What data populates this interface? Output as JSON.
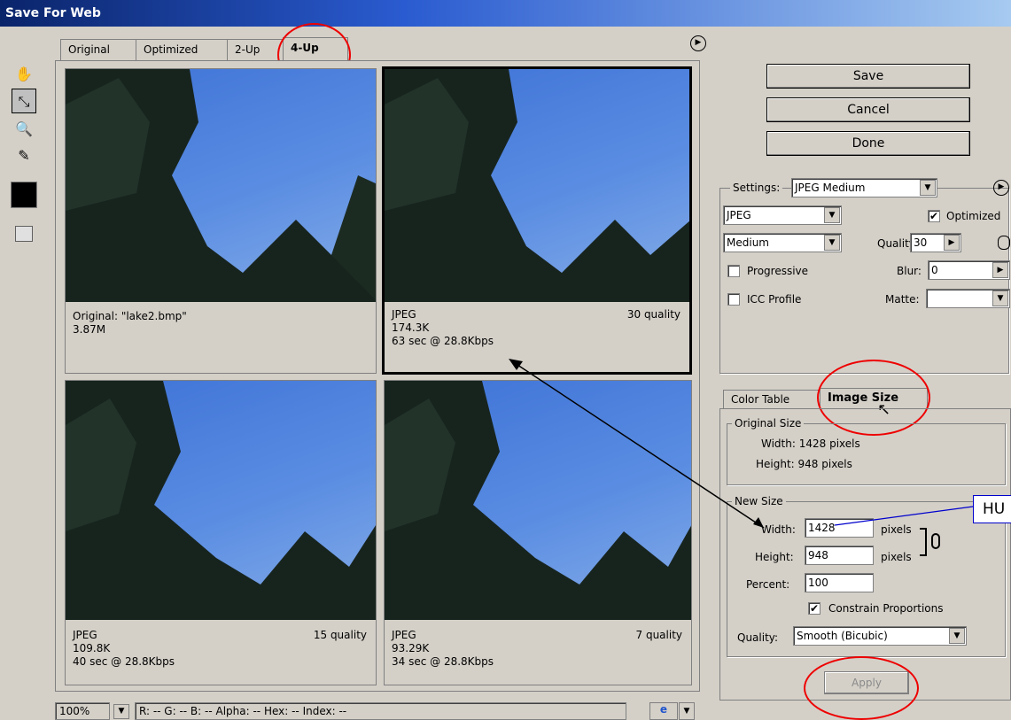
{
  "window": {
    "title": "Save For Web"
  },
  "tabs": [
    {
      "label": "Original"
    },
    {
      "label": "Optimized"
    },
    {
      "label": "2-Up"
    },
    {
      "label": "4-Up",
      "active": true
    }
  ],
  "tools": [
    "hand-icon",
    "slice-select-icon",
    "zoom-icon",
    "eyedropper-icon"
  ],
  "panes": {
    "original": {
      "name": "Original: \"lake2.bmp\"",
      "size": "3.87M"
    },
    "pane2": {
      "format": "JPEG",
      "quality": "30 quality",
      "size": "174.3K",
      "time": "63 sec @ 28.8Kbps"
    },
    "pane3": {
      "format": "JPEG",
      "quality": "15 quality",
      "size": "109.8K",
      "time": "40 sec @ 28.8Kbps"
    },
    "pane4": {
      "format": "JPEG",
      "quality": "7 quality",
      "size": "93.29K",
      "time": "34 sec @ 28.8Kbps"
    }
  },
  "buttons": {
    "save": "Save",
    "cancel": "Cancel",
    "done": "Done",
    "apply": "Apply"
  },
  "settings": {
    "label": "Settings:",
    "preset": "JPEG Medium",
    "format": "JPEG",
    "quality_preset": "Medium",
    "optimized_label": "Optimized",
    "optimized_checked": true,
    "quality_label": "Quality:",
    "quality_value": "30",
    "progressive_label": "Progressive",
    "blur_label": "Blur:",
    "blur_value": "0",
    "icc_label": "ICC Profile",
    "matte_label": "Matte:"
  },
  "size_tabs": {
    "color_table": "Color Table",
    "image_size": "Image Size"
  },
  "original_size": {
    "legend": "Original Size",
    "width": "Width: 1428 pixels",
    "height": "Height: 948 pixels"
  },
  "new_size": {
    "legend": "New Size",
    "width_label": "Width:",
    "width_value": "1428",
    "height_label": "Height:",
    "height_value": "948",
    "pixels": "pixels",
    "percent_label": "Percent:",
    "percent_value": "100",
    "constrain_label": "Constrain Proportions",
    "constrain_checked": true,
    "quality_label": "Quality:",
    "quality_value": "Smooth (Bicubic)"
  },
  "annotation": {
    "callout_text": "HU"
  },
  "status_bar": {
    "zoom": "100%",
    "readout": "R:   --   G:   --   B:   --   Alpha:    --  Hex:           --  Index:    --"
  },
  "colors": {
    "swatch": "#000000",
    "annotation_red": "#e00000",
    "annotation_blue": "#0000cc"
  }
}
